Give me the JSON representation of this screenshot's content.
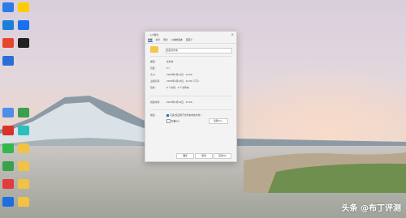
{
  "dialog": {
    "title": "…(2)属性",
    "tabs": [
      "常规",
      "共享",
      "安全",
      "以前的版本",
      "自定义"
    ],
    "name_value": "新建文件夹",
    "rows": [
      {
        "label": "类型:",
        "value": "文件夹"
      },
      {
        "label": "位置:",
        "value": "C:\\"
      },
      {
        "label": "大小:",
        "value": "2023年2月14日，12:00"
      },
      {
        "label": "占用空间:",
        "value": "2023年2月14日，12:00 (下午)"
      },
      {
        "label": "包含:",
        "value": "0 个文件，0 个文件夹"
      },
      {
        "label": "创建时间:",
        "value": "2023年2月14日，12:00"
      },
      {
        "label": "属性:",
        "value": "只读(仅应用于文件夹中的文件)"
      }
    ],
    "hidden_label": "隐藏(H)",
    "advanced_label": "高级(D)...",
    "ok_label": "确定",
    "cancel_label": "取消",
    "apply_label": "应用(A)"
  },
  "watermark": "头条 @布丁评测",
  "desktop_icons": [
    {
      "label": "",
      "color": "#2d7be8",
      "icon": "computer-icon"
    },
    {
      "label": "",
      "color": "#ffcc00",
      "icon": "app-icon"
    },
    {
      "label": "",
      "color": "#1a7fd8",
      "icon": "app-icon"
    },
    {
      "label": "",
      "color": "#1d6ff2",
      "icon": "app-icon"
    },
    {
      "label": "",
      "color": "#e6462f",
      "icon": "app-icon"
    },
    {
      "label": "",
      "color": "#222222",
      "icon": "app-icon"
    },
    {
      "label": "",
      "color": "#2a6fd8",
      "icon": "app-icon"
    },
    {
      "label": "",
      "color": "#4e8ee8",
      "icon": "app-icon"
    },
    {
      "label": "",
      "color": "#3aa04c",
      "icon": "app-icon"
    },
    {
      "label": "",
      "color": "#d8322a",
      "icon": "app-icon"
    },
    {
      "label": "",
      "color": "#2bbfc0",
      "icon": "app-icon"
    },
    {
      "label": "",
      "color": "#33b84a",
      "icon": "app-icon"
    },
    {
      "label": "",
      "color": "#f2c244",
      "icon": "folder-icon"
    },
    {
      "label": "",
      "color": "#3aa04c",
      "icon": "app-icon"
    },
    {
      "label": "",
      "color": "#f2c244",
      "icon": "folder-icon"
    },
    {
      "label": "",
      "color": "#e33b3b",
      "icon": "app-icon"
    },
    {
      "label": "",
      "color": "#f2c244",
      "icon": "folder-icon"
    },
    {
      "label": "",
      "color": "#1d6fe0",
      "icon": "app-icon"
    },
    {
      "label": "",
      "color": "#f2c244",
      "icon": "folder-icon"
    }
  ]
}
